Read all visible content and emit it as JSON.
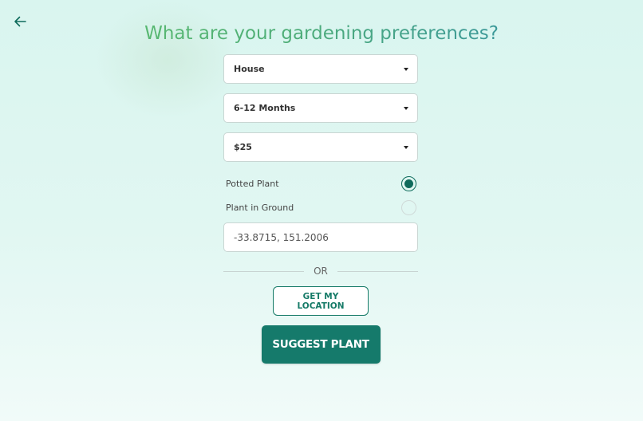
{
  "header": {
    "title": "What are your gardening preferences?",
    "back_icon": "arrow-left-icon"
  },
  "form": {
    "location_type": {
      "value": "House"
    },
    "duration": {
      "value": "6-12 Months"
    },
    "budget": {
      "value": "$25"
    },
    "planting_options": [
      {
        "label": "Potted Plant",
        "checked": true
      },
      {
        "label": "Plant in Ground",
        "checked": false
      }
    ],
    "coordinates": {
      "value": "-33.8715, 151.2006"
    },
    "divider_text": "OR",
    "get_location_label": "GET MY LOCATION",
    "suggest_label": "SUGGEST PLANT"
  },
  "colors": {
    "accent": "#157a6b",
    "title_gradient_start": "#62c26a",
    "title_gradient_end": "#2f8ab0",
    "background": "#d9f5ef"
  }
}
